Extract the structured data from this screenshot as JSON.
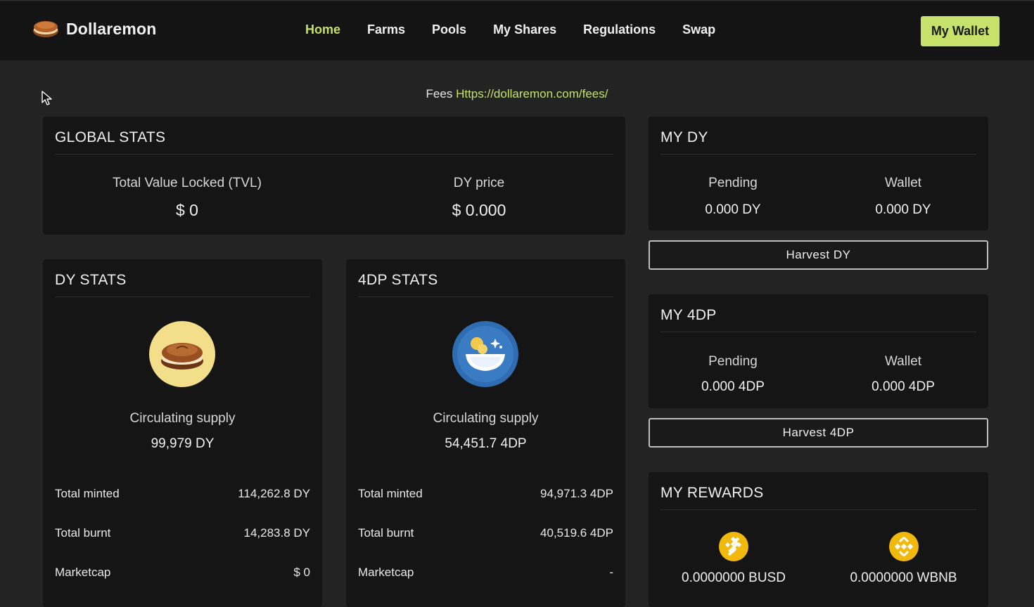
{
  "header": {
    "brand": "Dollaremon",
    "nav": [
      "Home",
      "Farms",
      "Pools",
      "My Shares",
      "Regulations",
      "Swap"
    ],
    "active_nav": "Home",
    "wallet_button": "My Wallet"
  },
  "fees": {
    "label": "Fees",
    "link": "Https://dollaremon.com/fees/"
  },
  "global_stats": {
    "title": "GLOBAL STATS",
    "tvl_label": "Total Value Locked (TVL)",
    "tvl_value": "$ 0",
    "price_label": "DY price",
    "price_value": "$ 0.000"
  },
  "dy_stats": {
    "title": "DY STATS",
    "supply_label": "Circulating supply",
    "supply_value": "99,979 DY",
    "rows": [
      {
        "label": "Total minted",
        "value": "114,262.8 DY"
      },
      {
        "label": "Total burnt",
        "value": "14,283.8 DY"
      },
      {
        "label": "Marketcap",
        "value": "$ 0"
      }
    ]
  },
  "dp_stats": {
    "title": "4DP STATS",
    "supply_label": "Circulating supply",
    "supply_value": "54,451.7 4DP",
    "rows": [
      {
        "label": "Total minted",
        "value": "94,971.3 4DP"
      },
      {
        "label": "Total burnt",
        "value": "40,519.6 4DP"
      },
      {
        "label": "Marketcap",
        "value": "-"
      }
    ]
  },
  "my_dy": {
    "title": "MY DY",
    "pending_label": "Pending",
    "pending_value": "0.000 DY",
    "wallet_label": "Wallet",
    "wallet_value": "0.000 DY",
    "harvest_button": "Harvest DY"
  },
  "my_4dp": {
    "title": "MY 4DP",
    "pending_label": "Pending",
    "pending_value": "0.000 4DP",
    "wallet_label": "Wallet",
    "wallet_value": "0.000 4DP",
    "harvest_button": "Harvest 4DP"
  },
  "my_rewards": {
    "title": "MY REWARDS",
    "busd": "0.0000000 BUSD",
    "wbnb": "0.0000000 WBNB"
  },
  "colors": {
    "accent": "#c7e26a",
    "background": "#232323",
    "card": "#151515",
    "topbar": "#141414",
    "binance_yellow": "#f0b90b"
  },
  "icons": [
    "dorayaki-logo-icon",
    "cursor-icon",
    "dorayaki-coin-icon",
    "bowl-coin-icon",
    "busd-icon",
    "wbnb-icon"
  ]
}
